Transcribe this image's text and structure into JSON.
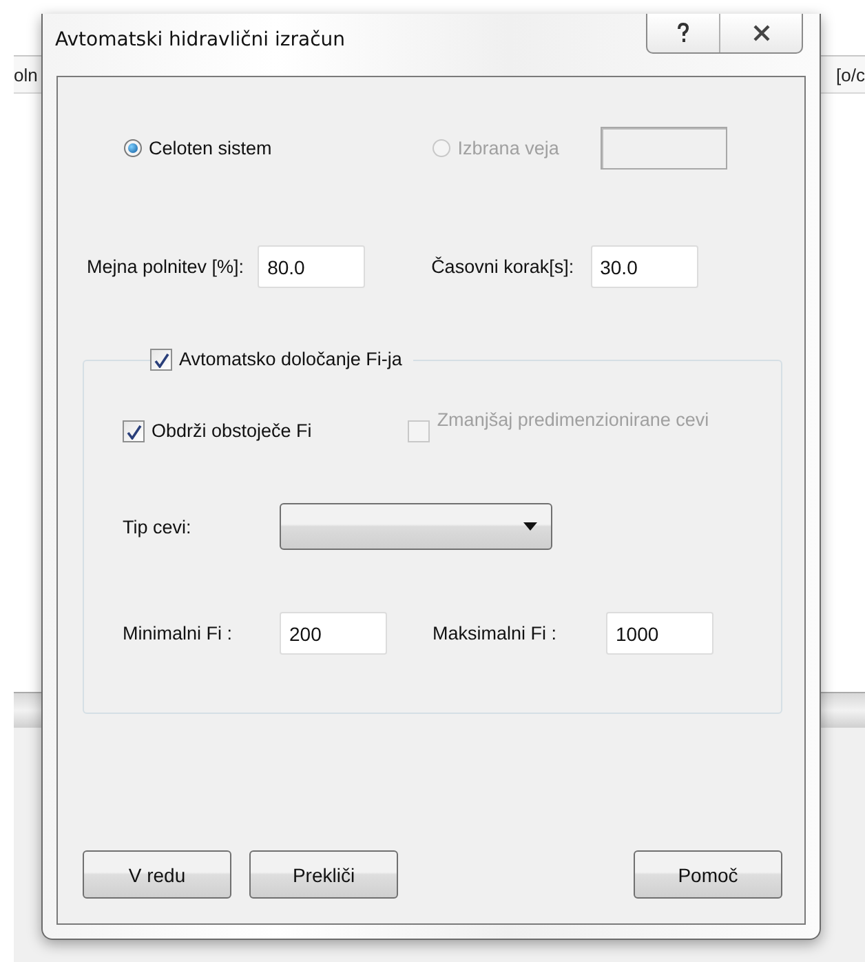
{
  "background_app": {
    "left_fragment": "oln",
    "right_fragment": "[o/c"
  },
  "window": {
    "title": "Avtomatski hidravlični izračun"
  },
  "scope": [
    {
      "label": "Celoten sistem",
      "selected": true,
      "disabled": false
    },
    {
      "label": "Izbrana veja",
      "selected": false,
      "disabled": true
    }
  ],
  "branch_field": {
    "disabled": true
  },
  "limits": [
    {
      "label": "Mejna polnitev [%]:",
      "value": "80.0"
    },
    {
      "label": "Časovni korak[s]:",
      "value": "30.0"
    }
  ],
  "auto_group": {
    "label": "Avtomatsko določanje Fi-ja",
    "checked": true,
    "options": [
      {
        "label": "Obdrži obstoječe Fi",
        "checked": true,
        "disabled": false
      },
      {
        "label": "Zmanjšaj predimenzionirane cevi",
        "checked": false,
        "disabled": true
      }
    ],
    "pipe_type": {
      "label": "Tip cevi:"
    },
    "range": [
      {
        "label": "Minimalni Fi :",
        "value": "200"
      },
      {
        "label": "Maksimalni Fi :",
        "value": "1000"
      }
    ]
  },
  "buttons": [
    "V redu",
    "Prekliči",
    "Pomoč"
  ]
}
